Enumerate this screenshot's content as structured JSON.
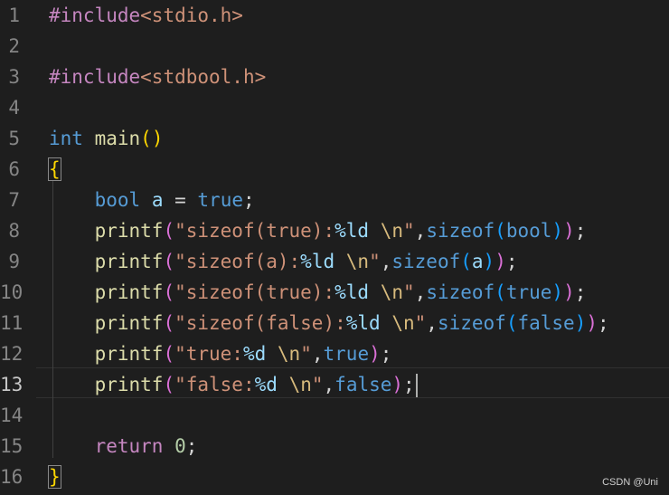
{
  "editor": {
    "line_numbers": [
      "1",
      "2",
      "3",
      "4",
      "5",
      "6",
      "7",
      "8",
      "9",
      "10",
      "11",
      "12",
      "13",
      "14",
      "15",
      "16"
    ],
    "active_line": "13",
    "lines": [
      [
        {
          "t": "#include",
          "c": "ctl"
        },
        {
          "t": "<stdio.h>",
          "c": "inc"
        }
      ],
      [],
      [
        {
          "t": "#include",
          "c": "ctl"
        },
        {
          "t": "<stdbool.h>",
          "c": "inc"
        }
      ],
      [],
      [
        {
          "t": "int",
          "c": "kw"
        },
        {
          "t": " ",
          "c": "op"
        },
        {
          "t": "main",
          "c": "fn"
        },
        {
          "t": "()",
          "c": "p1"
        }
      ],
      [
        {
          "t": "{",
          "c": "p1"
        }
      ],
      [
        {
          "t": "    ",
          "c": "op"
        },
        {
          "t": "bool",
          "c": "kw"
        },
        {
          "t": " ",
          "c": "op"
        },
        {
          "t": "a",
          "c": "var"
        },
        {
          "t": " = ",
          "c": "op"
        },
        {
          "t": "true",
          "c": "kw"
        },
        {
          "t": ";",
          "c": "op"
        }
      ],
      [
        {
          "t": "    ",
          "c": "op"
        },
        {
          "t": "printf",
          "c": "fn"
        },
        {
          "t": "(",
          "c": "p2"
        },
        {
          "t": "\"sizeof(true):",
          "c": "str"
        },
        {
          "t": "%ld",
          "c": "fmt"
        },
        {
          "t": " ",
          "c": "str"
        },
        {
          "t": "\\n",
          "c": "esc"
        },
        {
          "t": "\"",
          "c": "str"
        },
        {
          "t": ",",
          "c": "op"
        },
        {
          "t": "sizeof",
          "c": "kw"
        },
        {
          "t": "(",
          "c": "p3"
        },
        {
          "t": "bool",
          "c": "kw"
        },
        {
          "t": ")",
          "c": "p3"
        },
        {
          "t": ")",
          "c": "p2"
        },
        {
          "t": ";",
          "c": "op"
        }
      ],
      [
        {
          "t": "    ",
          "c": "op"
        },
        {
          "t": "printf",
          "c": "fn"
        },
        {
          "t": "(",
          "c": "p2"
        },
        {
          "t": "\"sizeof(a):",
          "c": "str"
        },
        {
          "t": "%ld",
          "c": "fmt"
        },
        {
          "t": " ",
          "c": "str"
        },
        {
          "t": "\\n",
          "c": "esc"
        },
        {
          "t": "\"",
          "c": "str"
        },
        {
          "t": ",",
          "c": "op"
        },
        {
          "t": "sizeof",
          "c": "kw"
        },
        {
          "t": "(",
          "c": "p3"
        },
        {
          "t": "a",
          "c": "var"
        },
        {
          "t": ")",
          "c": "p3"
        },
        {
          "t": ")",
          "c": "p2"
        },
        {
          "t": ";",
          "c": "op"
        }
      ],
      [
        {
          "t": "    ",
          "c": "op"
        },
        {
          "t": "printf",
          "c": "fn"
        },
        {
          "t": "(",
          "c": "p2"
        },
        {
          "t": "\"sizeof(true):",
          "c": "str"
        },
        {
          "t": "%ld",
          "c": "fmt"
        },
        {
          "t": " ",
          "c": "str"
        },
        {
          "t": "\\n",
          "c": "esc"
        },
        {
          "t": "\"",
          "c": "str"
        },
        {
          "t": ",",
          "c": "op"
        },
        {
          "t": "sizeof",
          "c": "kw"
        },
        {
          "t": "(",
          "c": "p3"
        },
        {
          "t": "true",
          "c": "kw"
        },
        {
          "t": ")",
          "c": "p3"
        },
        {
          "t": ")",
          "c": "p2"
        },
        {
          "t": ";",
          "c": "op"
        }
      ],
      [
        {
          "t": "    ",
          "c": "op"
        },
        {
          "t": "printf",
          "c": "fn"
        },
        {
          "t": "(",
          "c": "p2"
        },
        {
          "t": "\"sizeof(false):",
          "c": "str"
        },
        {
          "t": "%ld",
          "c": "fmt"
        },
        {
          "t": " ",
          "c": "str"
        },
        {
          "t": "\\n",
          "c": "esc"
        },
        {
          "t": "\"",
          "c": "str"
        },
        {
          "t": ",",
          "c": "op"
        },
        {
          "t": "sizeof",
          "c": "kw"
        },
        {
          "t": "(",
          "c": "p3"
        },
        {
          "t": "false",
          "c": "kw"
        },
        {
          "t": ")",
          "c": "p3"
        },
        {
          "t": ")",
          "c": "p2"
        },
        {
          "t": ";",
          "c": "op"
        }
      ],
      [
        {
          "t": "    ",
          "c": "op"
        },
        {
          "t": "printf",
          "c": "fn"
        },
        {
          "t": "(",
          "c": "p2"
        },
        {
          "t": "\"true:",
          "c": "str"
        },
        {
          "t": "%d",
          "c": "fmt"
        },
        {
          "t": " ",
          "c": "str"
        },
        {
          "t": "\\n",
          "c": "esc"
        },
        {
          "t": "\"",
          "c": "str"
        },
        {
          "t": ",",
          "c": "op"
        },
        {
          "t": "true",
          "c": "kw"
        },
        {
          "t": ")",
          "c": "p2"
        },
        {
          "t": ";",
          "c": "op"
        }
      ],
      [
        {
          "t": "    ",
          "c": "op"
        },
        {
          "t": "printf",
          "c": "fn"
        },
        {
          "t": "(",
          "c": "p2"
        },
        {
          "t": "\"false:",
          "c": "str"
        },
        {
          "t": "%d",
          "c": "fmt"
        },
        {
          "t": " ",
          "c": "str"
        },
        {
          "t": "\\n",
          "c": "esc"
        },
        {
          "t": "\"",
          "c": "str"
        },
        {
          "t": ",",
          "c": "op"
        },
        {
          "t": "false",
          "c": "kw"
        },
        {
          "t": ")",
          "c": "p2"
        },
        {
          "t": ";",
          "c": "op"
        },
        {
          "t": "",
          "c": "cursor"
        }
      ],
      [],
      [
        {
          "t": "    ",
          "c": "op"
        },
        {
          "t": "return",
          "c": "ctl"
        },
        {
          "t": " ",
          "c": "op"
        },
        {
          "t": "0",
          "c": "num"
        },
        {
          "t": ";",
          "c": "op"
        }
      ],
      [
        {
          "t": "}",
          "c": "p1"
        }
      ]
    ]
  },
  "watermark": "CSDN @Uni",
  "colors": {
    "background": "#1e1e1e",
    "keyword": "#569cd6",
    "control": "#c586c0",
    "function": "#dcdcaa",
    "string": "#ce9178",
    "bracket1": "#ffd700",
    "bracket2": "#da70d6",
    "bracket3": "#179fff"
  }
}
